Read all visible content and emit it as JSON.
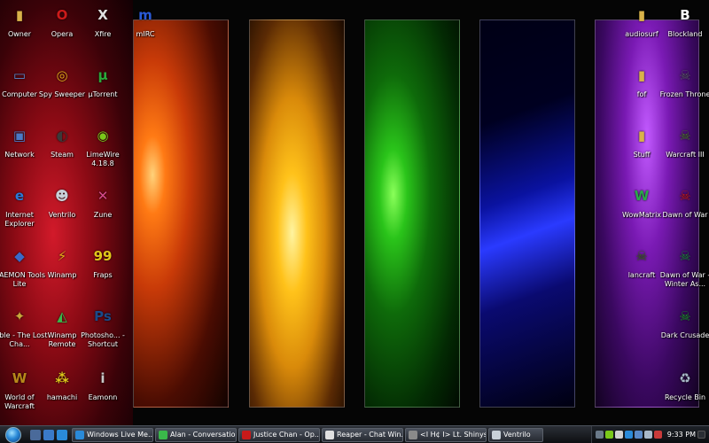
{
  "desktop": {
    "icons": [
      {
        "label": "Owner",
        "glyph": "▮",
        "color": "#d9b24a",
        "shortcut": false
      },
      {
        "label": "Opera",
        "glyph": "O",
        "color": "#cc1a1a",
        "shortcut": true
      },
      {
        "label": "Xfire",
        "glyph": "X",
        "color": "#e0e0e0",
        "shortcut": true
      },
      {
        "label": "mIRC",
        "glyph": "m",
        "color": "#2a5ad8",
        "shortcut": true
      },
      {
        "label": "Computer",
        "glyph": "▭",
        "color": "#5a8ad0",
        "shortcut": false
      },
      {
        "label": "Spy Sweeper",
        "glyph": "◎",
        "color": "#e0a81a",
        "shortcut": true
      },
      {
        "label": "µTorrent",
        "glyph": "µ",
        "color": "#2aa83a",
        "shortcut": true
      },
      {
        "label": "Network",
        "glyph": "▣",
        "color": "#4a7ac8",
        "shortcut": false
      },
      {
        "label": "Steam",
        "glyph": "◐",
        "color": "#3a3a3a",
        "shortcut": true
      },
      {
        "label": "LimeWire 4.18.8",
        "glyph": "◉",
        "color": "#7ac81a",
        "shortcut": true
      },
      {
        "label": "Internet Explorer",
        "glyph": "e",
        "color": "#2a7ad8",
        "shortcut": false
      },
      {
        "label": "Ventrilo",
        "glyph": "☻",
        "color": "#c8d0d8",
        "shortcut": true
      },
      {
        "label": "Zune",
        "glyph": "✕",
        "color": "#d84a8a",
        "shortcut": true
      },
      {
        "label": "DAEMON Tools Lite",
        "glyph": "◆",
        "color": "#3a6ac8",
        "shortcut": true
      },
      {
        "label": "Winamp",
        "glyph": "⚡",
        "color": "#e8a81a",
        "shortcut": true
      },
      {
        "label": "Fraps",
        "glyph": "99",
        "color": "#e0c81a",
        "shortcut": true
      },
      {
        "label": "Fable - The Lost Cha...",
        "glyph": "✦",
        "color": "#c8a83a",
        "shortcut": true
      },
      {
        "label": "Winamp Remote",
        "glyph": "◭",
        "color": "#3ab84a",
        "shortcut": true
      },
      {
        "label": "Photosho... - Shortcut",
        "glyph": "Ps",
        "color": "#1a4a8a",
        "shortcut": true
      },
      {
        "label": "World of Warcraft",
        "glyph": "W",
        "color": "#b8881a",
        "shortcut": true
      },
      {
        "label": "hamachi",
        "glyph": "⁂",
        "color": "#e0c81a",
        "shortcut": false
      },
      {
        "label": "Eamonn",
        "glyph": "i",
        "color": "#c8c8c8",
        "shortcut": false
      }
    ],
    "right_icons": [
      {
        "label": "audiosurf",
        "glyph": "▮",
        "color": "#d9b24a",
        "shortcut": false
      },
      {
        "label": "Blockland",
        "glyph": "B",
        "color": "#ffffff",
        "shortcut": true
      },
      {
        "label": "fof",
        "glyph": "▮",
        "color": "#d9b24a",
        "shortcut": true
      },
      {
        "label": "Frozen Throne",
        "glyph": "☠",
        "color": "#5a5a6a",
        "shortcut": true
      },
      {
        "label": "Stuff",
        "glyph": "▮",
        "color": "#d9b24a",
        "shortcut": false
      },
      {
        "label": "Warcraft III",
        "glyph": "☠",
        "color": "#4a7a2a",
        "shortcut": true
      },
      {
        "label": "WowMatrix",
        "glyph": "W",
        "color": "#2aa84a",
        "shortcut": true
      },
      {
        "label": "Dawn of War",
        "glyph": "☠",
        "color": "#c81a1a",
        "shortcut": true
      },
      {
        "label": "lancraft",
        "glyph": "☠",
        "color": "#3a6a1a",
        "shortcut": true
      },
      {
        "label": "Dawn of War - Winter As...",
        "glyph": "☠",
        "color": "#1a8a3a",
        "shortcut": true
      },
      {
        "label": "Dark Crusade",
        "glyph": "☠",
        "color": "#1a9a2a",
        "shortcut": true
      },
      {
        "label": "Recycle Bin",
        "glyph": "♻",
        "color": "#a8b8c8",
        "shortcut": false
      }
    ]
  },
  "taskbar": {
    "start_label": "Start",
    "tasks": [
      {
        "label": "Windows Live Me...",
        "color": "#2a8ad8"
      },
      {
        "label": "Alan - Conversation",
        "color": "#3ab84a"
      },
      {
        "label": "Justice Chan - Op...",
        "color": "#c81a1a"
      },
      {
        "label": "Reaper - Chat Win...",
        "color": "#e0e0e0"
      },
      {
        "label": "<I H¢ I> Lt. Shinys...",
        "color": "#8a8a8a"
      },
      {
        "label": "Ventrilo",
        "color": "#c8d0d8"
      }
    ],
    "clock": "9:33 PM"
  },
  "colors": {
    "taskbar": "#1a1d22",
    "icon_label": "#ffffff"
  }
}
